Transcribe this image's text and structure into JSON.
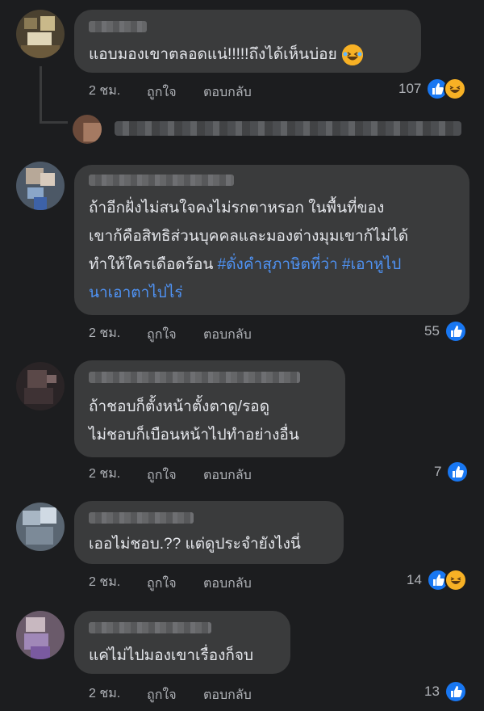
{
  "comments": [
    {
      "text": "แอบมองเขาตลอดแน่!!!!!ถึงได้เห็นบ่อย",
      "time": "2 ชม.",
      "like": "ถูกใจ",
      "reply": "ตอบกลับ",
      "reaction_count": "107",
      "reactions": [
        "like-icon",
        "haha-icon"
      ]
    },
    {
      "text_plain": "ถ้าอีกฝั่งไม่สนใจคงไม่รกตาหรอก ในพื้นที่ของ\nเขาก้คือสิทธิส่วนบุคคลและมองต่างมุมเขาก้ไม่ได้\nทำให้ใครเดือดร้อน ",
      "hashtag1": "#ดั่งคำสุภาษิตที่ว่า",
      "hashtag2": "#เอาหูไป",
      "hashtag3": "นาเอาตาไปไร่",
      "time": "2 ชม.",
      "like": "ถูกใจ",
      "reply": "ตอบกลับ",
      "reaction_count": "55",
      "reactions": [
        "like-icon"
      ]
    },
    {
      "text": "ถ้าชอบก็ตั้งหน้าตั้งตาดู/รอดู\nไม่ชอบก็เบือนหน้าไปทำอย่างอื่น",
      "time": "2 ชม.",
      "like": "ถูกใจ",
      "reply": "ตอบกลับ",
      "reaction_count": "7",
      "reactions": [
        "like-icon"
      ]
    },
    {
      "text": "เออไม่ชอบ.?? แต่ดูประจำยังไงนี่",
      "time": "2 ชม.",
      "like": "ถูกใจ",
      "reply": "ตอบกลับ",
      "reaction_count": "14",
      "reactions": [
        "like-icon",
        "haha-icon"
      ]
    },
    {
      "text": "แค่ไม่ไปมองเขาเรื่องก็จบ",
      "time": "2 ชม.",
      "like": "ถูกใจ",
      "reply": "ตอบกลับ",
      "reaction_count": "13",
      "reactions": [
        "like-icon"
      ]
    }
  ],
  "colors": {
    "background": "#1c1d1f",
    "bubble": "#3a3b3c",
    "text": "#e4e6eb",
    "meta": "#b0b3b8",
    "hashtag": "#4f93f5",
    "like_blue": "#1877f2",
    "haha_yellow": "#f7b125"
  }
}
